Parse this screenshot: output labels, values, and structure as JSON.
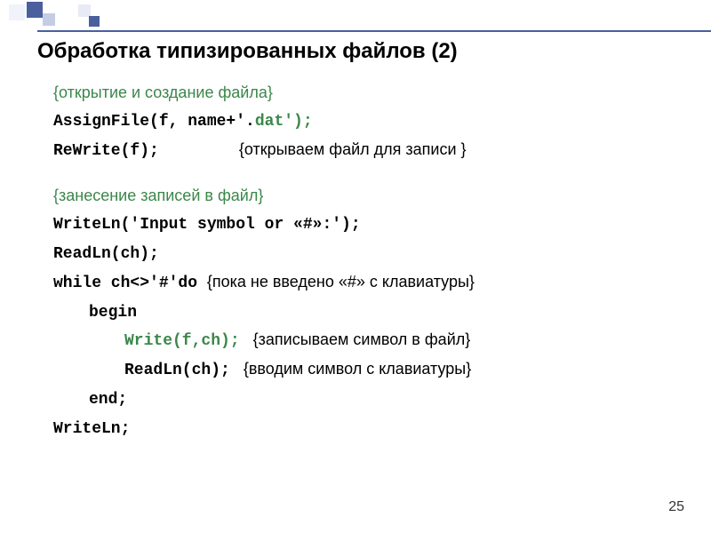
{
  "title": "Обработка типизированных файлов (2)",
  "page_number": "25",
  "lines": {
    "c1": "{открытие и создание файла}",
    "l2a": "AssignFile(f, name+'.",
    "l2b": "dat');",
    "l3a": "ReWrite(f);",
    "l3b": "{открываем файл для записи }",
    "c2": "{занесение записей в файл}",
    "l5": "WriteLn('Input symbol or  «#»:');",
    "l6": "ReadLn(ch);",
    "l7a": "while ch<>'#'do ",
    "l7b": "{пока не введено «#» с клавиатуры}",
    "l8": "begin",
    "l9a": "Write(f,ch);",
    "l9b": "{записываем символ в файл}",
    "l10a": "ReadLn(ch);",
    "l10b": "{вводим символ с клавиатуры}",
    "l11": "end;",
    "l12": "WriteLn;"
  }
}
